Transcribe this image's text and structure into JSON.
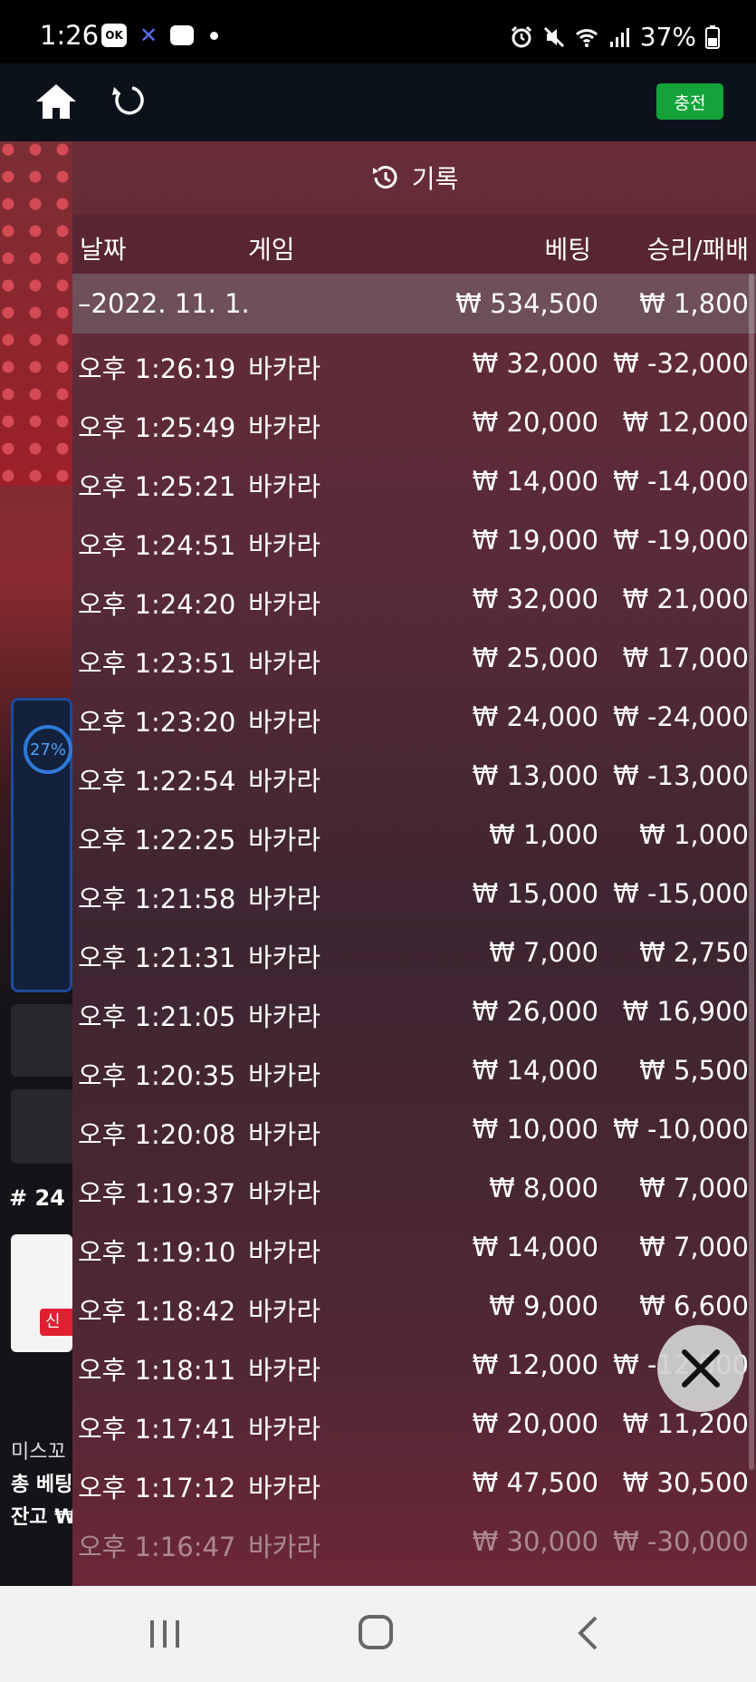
{
  "status_bar": {
    "time": "1:26",
    "app_icon_label": "OK",
    "battery": "37%",
    "icons": [
      "ok-app-icon",
      "x-app-icon",
      "chat-icon",
      "dot-icon",
      "alarm-icon",
      "mute-icon",
      "wifi-icon",
      "signal-icon",
      "battery-icon"
    ]
  },
  "app_bar": {
    "charge_label": "충전",
    "charge_color": "#13a33a"
  },
  "background": {
    "progress_percent": "27%",
    "room_number": "# 24",
    "new_badge": "신",
    "line1": "미스꼬",
    "line2": "총 베팅",
    "line3": "잔고 ₩"
  },
  "history": {
    "title": "기록",
    "columns": {
      "date": "날짜",
      "game": "게임",
      "bet": "베팅",
      "result": "승리/패배"
    },
    "summary": {
      "date": "–2022. 11. 1.",
      "bet": "₩ 534,500",
      "result": "₩ 1,800"
    },
    "rows": [
      {
        "time": "오후 1:26:19",
        "game": "바카라",
        "bet": "₩ 32,000",
        "result": "₩ -32,000"
      },
      {
        "time": "오후 1:25:49",
        "game": "바카라",
        "bet": "₩ 20,000",
        "result": "₩ 12,000"
      },
      {
        "time": "오후 1:25:21",
        "game": "바카라",
        "bet": "₩ 14,000",
        "result": "₩ -14,000"
      },
      {
        "time": "오후 1:24:51",
        "game": "바카라",
        "bet": "₩ 19,000",
        "result": "₩ -19,000"
      },
      {
        "time": "오후 1:24:20",
        "game": "바카라",
        "bet": "₩ 32,000",
        "result": "₩ 21,000"
      },
      {
        "time": "오후 1:23:51",
        "game": "바카라",
        "bet": "₩ 25,000",
        "result": "₩ 17,000"
      },
      {
        "time": "오후 1:23:20",
        "game": "바카라",
        "bet": "₩ 24,000",
        "result": "₩ -24,000"
      },
      {
        "time": "오후 1:22:54",
        "game": "바카라",
        "bet": "₩ 13,000",
        "result": "₩ -13,000"
      },
      {
        "time": "오후 1:22:25",
        "game": "바카라",
        "bet": "₩ 1,000",
        "result": "₩ 1,000"
      },
      {
        "time": "오후 1:21:58",
        "game": "바카라",
        "bet": "₩ 15,000",
        "result": "₩ -15,000"
      },
      {
        "time": "오후 1:21:31",
        "game": "바카라",
        "bet": "₩ 7,000",
        "result": "₩ 2,750"
      },
      {
        "time": "오후 1:21:05",
        "game": "바카라",
        "bet": "₩ 26,000",
        "result": "₩ 16,900"
      },
      {
        "time": "오후 1:20:35",
        "game": "바카라",
        "bet": "₩ 14,000",
        "result": "₩ 5,500"
      },
      {
        "time": "오후 1:20:08",
        "game": "바카라",
        "bet": "₩ 10,000",
        "result": "₩ -10,000"
      },
      {
        "time": "오후 1:19:37",
        "game": "바카라",
        "bet": "₩ 8,000",
        "result": "₩ 7,000"
      },
      {
        "time": "오후 1:19:10",
        "game": "바카라",
        "bet": "₩ 14,000",
        "result": "₩ 7,000"
      },
      {
        "time": "오후 1:18:42",
        "game": "바카라",
        "bet": "₩ 9,000",
        "result": "₩ 6,600"
      },
      {
        "time": "오후 1:18:11",
        "game": "바카라",
        "bet": "₩ 12,000",
        "result": "₩ -12,000"
      },
      {
        "time": "오후 1:17:41",
        "game": "바카라",
        "bet": "₩ 20,000",
        "result": "₩ 11,200"
      },
      {
        "time": "오후 1:17:12",
        "game": "바카라",
        "bet": "₩ 47,500",
        "result": "₩ 30,500"
      },
      {
        "time": "오후 1:16:47",
        "game": "바카라",
        "bet": "₩ 30,000",
        "result": "₩ -30,000"
      }
    ]
  }
}
